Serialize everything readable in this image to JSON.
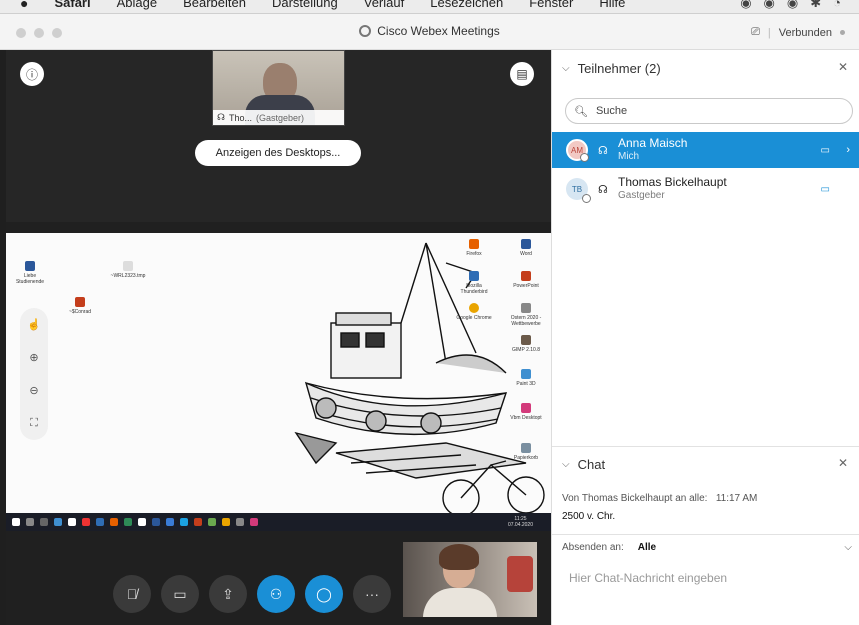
{
  "menubar": {
    "apple": "",
    "app_name": "Safari",
    "items": [
      "Ablage",
      "Bearbeiten",
      "Darstellung",
      "Verlauf",
      "Lesezeichen",
      "Fenster",
      "Hilfe"
    ]
  },
  "window": {
    "title": "Cisco Webex Meetings",
    "status": "Verbunden"
  },
  "stage": {
    "host_caption_name": "Tho...",
    "host_caption_role": "(Gastgeber)",
    "show_desktop_label": "Anzeigen des Desktops...",
    "taskbar_time": "11:25",
    "taskbar_date": "07.04.2020",
    "desktop_icons": [
      {
        "label": "Firefox",
        "color": "#e66000"
      },
      {
        "label": "Word",
        "color": "#2b579a"
      },
      {
        "label": "Mozilla Thunderbird",
        "color": "#2f6db5"
      },
      {
        "label": "PowerPoint",
        "color": "#c43e1c"
      },
      {
        "label": "Google Chrome",
        "color": "#e9a400"
      },
      {
        "label": "Ostern 2020 - Wettbewerbe",
        "color": "#888888"
      },
      {
        "label": "GIMP 2.10.8",
        "color": "#6b5a4a"
      },
      {
        "label": "Paint 3D",
        "color": "#3f8fd0"
      },
      {
        "label": "Vbm Desktopt",
        "color": "#d33a7b"
      },
      {
        "label": "Papierkorb",
        "color": "#7a8fa0"
      },
      {
        "label": "Liebe Studienende",
        "color": "#2b579a"
      },
      {
        "label": "~WRL2323.tmp",
        "color": "#aaaaaa"
      },
      {
        "label": "~$Conrad",
        "color": "#c43e1c"
      }
    ]
  },
  "panel": {
    "participants_title": "Teilnehmer (2)",
    "search_placeholder": "Suche",
    "participants": [
      {
        "initials": "AM",
        "name": "Anna Maisch",
        "role": "Mich"
      },
      {
        "initials": "TB",
        "name": "Thomas Bickelhaupt",
        "role": "Gastgeber"
      }
    ],
    "chat_title": "Chat",
    "chat_message_header": "Von Thomas Bickelhaupt an alle:",
    "chat_message_time": "11:17 AM",
    "chat_message_text": "2500 v. Chr.",
    "send_to_label": "Absenden an:",
    "send_to_value": "Alle",
    "chat_input_placeholder": "Hier Chat-Nachricht eingeben"
  },
  "icons": {
    "info": "info-icon",
    "layout": "layout-icon",
    "mute": "microphone-muted-icon",
    "video": "video-icon",
    "share": "share-icon",
    "participants": "participants-icon",
    "chat": "chat-icon",
    "more": "more-icon"
  },
  "colors": {
    "accent": "#1a8fd6",
    "stage_bg": "#202020",
    "panel_bg": "#ffffff"
  }
}
